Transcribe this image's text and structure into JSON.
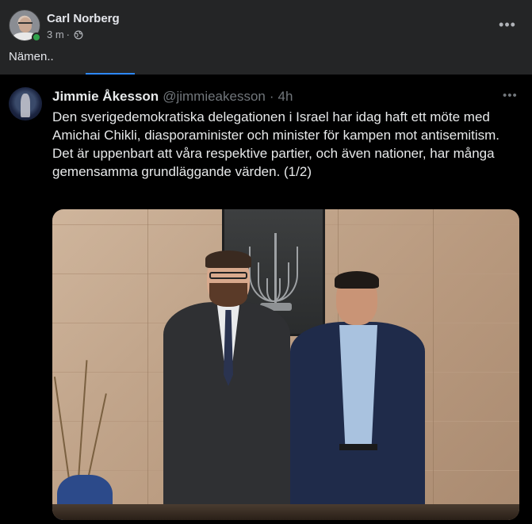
{
  "post": {
    "author": "Carl Norberg",
    "time": "3 m",
    "separator": "·",
    "privacy_icon": "globe-icon",
    "text": "Nämen..",
    "more_label": "•••"
  },
  "tweet": {
    "name": "Jimmie Åkesson",
    "handle": "@jimmieakesson",
    "separator": "·",
    "time": "4h",
    "more_label": "•••",
    "body_lines": [
      "Den sverigedemokratiska delegationen i Israel har idag haft ett möte med Amichai Chikli, diasporaminister och minister för kampen mot antisemitism.",
      "Det är uppenbart att våra respektive partier, och även nationer, har många gemensamma grundläggande värden. (1/2)"
    ]
  },
  "colors": {
    "background": "#242526",
    "tweet_background": "#000000",
    "accent": "#2d88ff",
    "online": "#31a24c"
  }
}
